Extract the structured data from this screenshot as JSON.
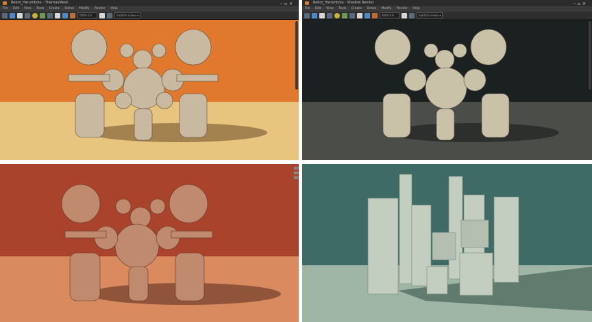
{
  "windows": [
    {
      "id": "orange",
      "title": "Rebro_Harumbolo - Thermo/Mesh",
      "menu": [
        "File",
        "Edit",
        "View",
        "Tools",
        "Create",
        "Select",
        "Modify",
        "Render",
        "Help"
      ],
      "field_1": "0000 0.9 …",
      "field_2": "Subtitle (view) ▾",
      "colors": {
        "wall": "#e0782d",
        "floor": "#e8c57e",
        "model": "#c9b9a0",
        "shadow": "#6a4a2a"
      }
    },
    {
      "id": "dark",
      "title": "Rebro_Harumbolo - Shadow Render",
      "menu": [
        "File",
        "Edit",
        "View",
        "Tools",
        "Create",
        "Select",
        "Modify",
        "Render",
        "Help"
      ],
      "field_1": "0000 0.9 …",
      "field_2": "Subtitle (view) ▾",
      "colors": {
        "wall": "#1b2120",
        "floor": "#4b4d49",
        "model": "#c9c1a8",
        "shadow": "#262827"
      }
    },
    {
      "id": "red",
      "title": "",
      "colors": {
        "wall": "#a9432b",
        "floor": "#d98a5e",
        "model": "#c08a6e",
        "shadow": "#5d3022"
      }
    },
    {
      "id": "teal",
      "title": "",
      "colors": {
        "wall": "#3f6b67",
        "floor": "#9fb5a5",
        "model": "#c3cdc0",
        "shadow": "#2f4a44"
      }
    }
  ]
}
